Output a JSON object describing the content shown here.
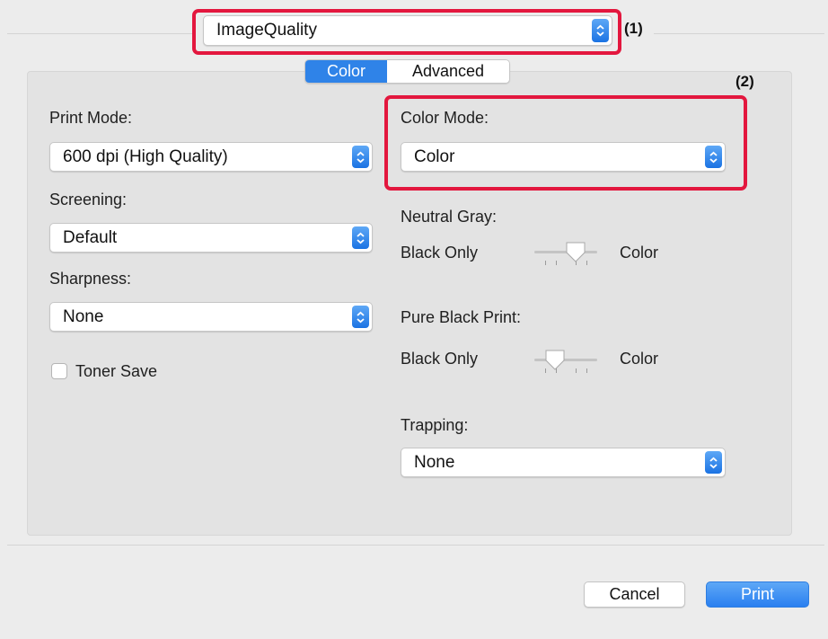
{
  "preset_popup": {
    "value": "ImageQuality"
  },
  "annotations": {
    "one": "(1)",
    "two": "(2)"
  },
  "tabs": [
    {
      "label": "Color",
      "active": true
    },
    {
      "label": "Advanced",
      "active": false
    }
  ],
  "left": {
    "print_mode": {
      "label": "Print Mode:",
      "value": "600 dpi (High Quality)"
    },
    "screening": {
      "label": "Screening:",
      "value": "Default"
    },
    "sharpness": {
      "label": "Sharpness:",
      "value": "None"
    },
    "toner_save": {
      "label": "Toner Save",
      "checked": false
    }
  },
  "right": {
    "color_mode": {
      "label": "Color Mode:",
      "value": "Color"
    },
    "neutral_gray": {
      "label": "Neutral Gray:",
      "left_label": "Black Only",
      "right_label": "Color",
      "position": 0.66
    },
    "pure_black_print": {
      "label": "Pure Black Print:",
      "left_label": "Black Only",
      "right_label": "Color",
      "position": 0.33
    },
    "trapping": {
      "label": "Trapping:",
      "value": "None"
    }
  },
  "buttons": {
    "cancel": "Cancel",
    "print": "Print"
  },
  "colors": {
    "highlight": "#e3173e",
    "accent": "#2f83e8"
  }
}
